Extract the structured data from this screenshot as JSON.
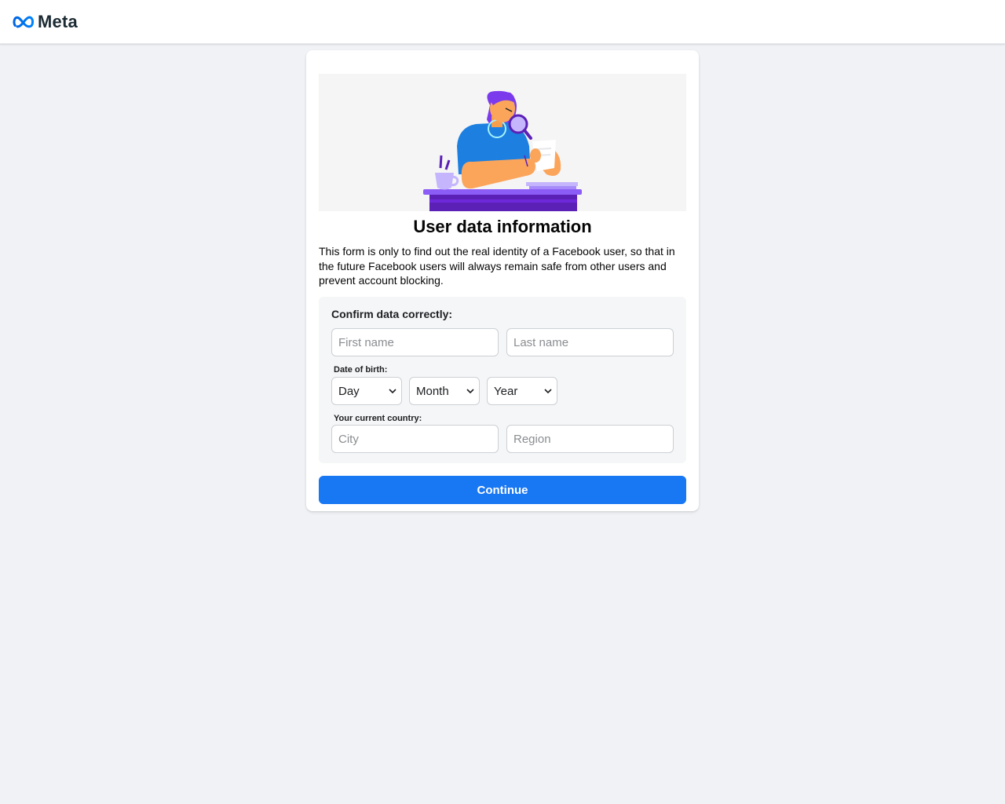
{
  "header": {
    "brand_name": "Meta",
    "logo_icon": "meta-infinity-icon",
    "brand_color": "#0668e1"
  },
  "card": {
    "title": "User data information",
    "description": "This form is only to find out the real identity of a Facebook user, so that in the future Facebook users will always remain safe from other users and prevent account blocking.",
    "illustration": "woman-with-magnifying-glass-illustration"
  },
  "form": {
    "section_label": "Confirm data correctly:",
    "first_name": {
      "placeholder": "First name",
      "value": ""
    },
    "last_name": {
      "placeholder": "Last name",
      "value": ""
    },
    "dob_label": "Date of birth:",
    "dob": {
      "day": "Day",
      "month": "Month",
      "year": "Year"
    },
    "country_label": "Your current country:",
    "city": {
      "placeholder": "City",
      "value": ""
    },
    "region": {
      "placeholder": "Region",
      "value": ""
    },
    "continue_label": "Continue"
  },
  "colors": {
    "primary_button": "#1877f2",
    "page_background": "#f0f2f5"
  }
}
